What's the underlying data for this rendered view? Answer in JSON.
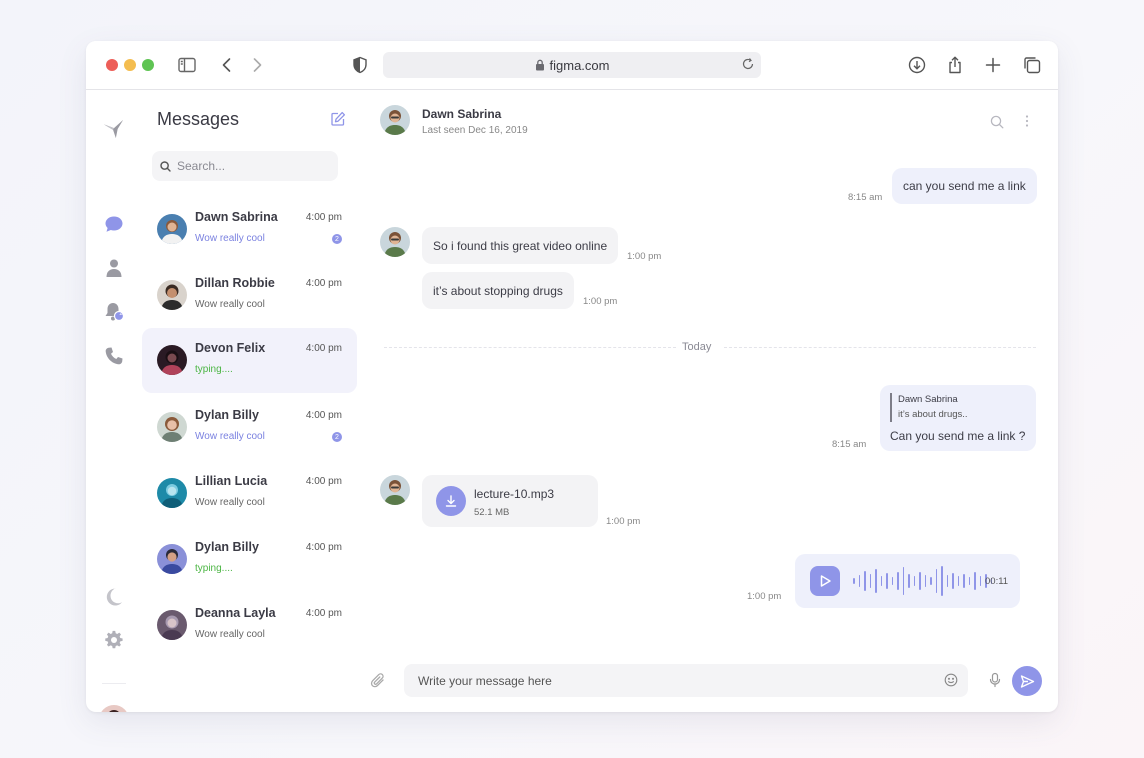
{
  "browser": {
    "url": "figma.com"
  },
  "sidebar_panel": {
    "title": "Messages",
    "search_placeholder": "Search...",
    "notification_count": "2",
    "conversations": [
      {
        "name": "Dawn Sabrina",
        "time": "4:00 pm",
        "preview": "Wow really cool",
        "style": "accent",
        "badge": "2"
      },
      {
        "name": "Dillan Robbie",
        "time": "4:00 pm",
        "preview": "Wow really cool",
        "style": "normal",
        "badge": ""
      },
      {
        "name": "Devon Felix",
        "time": "4:00 pm",
        "preview": "typing....",
        "style": "typing",
        "badge": ""
      },
      {
        "name": "Dylan Billy",
        "time": "4:00 pm",
        "preview": "Wow really cool",
        "style": "accent",
        "badge": "2"
      },
      {
        "name": "Lillian Lucia",
        "time": "4:00 pm",
        "preview": "Wow really cool",
        "style": "normal",
        "badge": ""
      },
      {
        "name": "Dylan Billy",
        "time": "4:00 pm",
        "preview": "typing....",
        "style": "typing",
        "badge": ""
      },
      {
        "name": "Deanna Layla",
        "time": "4:00 pm",
        "preview": "Wow really cool",
        "style": "normal",
        "badge": ""
      }
    ]
  },
  "chat": {
    "contact_name": "Dawn Sabrina",
    "last_seen": "Last seen Dec 16, 2019",
    "messages": {
      "m1": {
        "text": "can you send me a link",
        "time": "8:15 am"
      },
      "m2": {
        "text": "So i found this great video online",
        "time": "1:00 pm"
      },
      "m3": {
        "text": "it’s about stopping drugs",
        "time": "1:00 pm"
      },
      "divider": "Today",
      "m4": {
        "reply_name": "Dawn Sabrina",
        "reply_text": "it’s about drugs..",
        "text": "Can you send me a link ?",
        "time": "8:15 am"
      },
      "m5": {
        "file_name": "lecture-10.mp3",
        "file_size": "52.1 MB",
        "time": "1:00 pm"
      },
      "m6": {
        "duration": "00:11",
        "time": "1:00 pm"
      }
    },
    "composer_placeholder": "Write your message here"
  },
  "colors": {
    "accent": "#8f95e8",
    "typing": "#4bb543",
    "bubble_out": "#eef0fb",
    "bubble_in": "#f3f3f5"
  },
  "icons": [
    "sidebar-icon",
    "back-icon",
    "forward-icon",
    "shield-icon",
    "lock-icon",
    "reload-icon",
    "download-icon",
    "share-icon",
    "plus-icon",
    "tabs-icon",
    "logo-icon",
    "chat-icon",
    "user-icon",
    "bell-icon",
    "phone-icon",
    "moon-icon",
    "gear-icon",
    "compose-icon",
    "search-icon",
    "more-icon",
    "attach-icon",
    "emoji-icon",
    "mic-icon",
    "send-icon",
    "play-icon"
  ]
}
